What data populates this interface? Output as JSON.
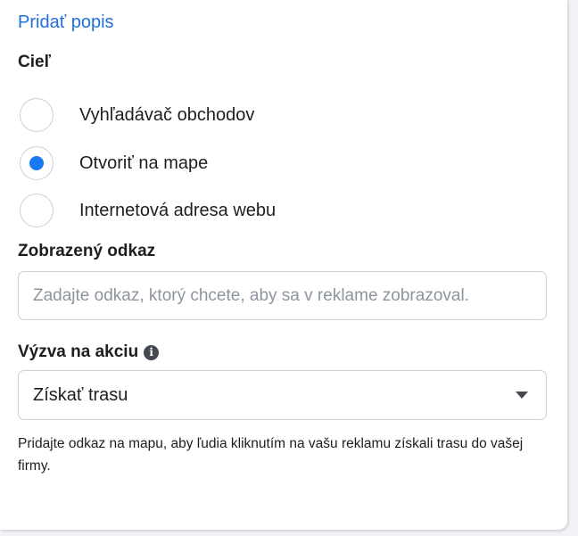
{
  "description_link": "Pridať popis",
  "goal": {
    "label": "Cieľ",
    "options": [
      {
        "label": "Vyhľadávač obchodov",
        "selected": false
      },
      {
        "label": "Otvoriť na mape",
        "selected": true
      },
      {
        "label": "Internetová adresa webu",
        "selected": false
      }
    ]
  },
  "display_link": {
    "label": "Zobrazený odkaz",
    "value": "",
    "placeholder": "Zadajte odkaz, ktorý chcete, aby sa v reklame zobrazoval."
  },
  "cta": {
    "label": "Výzva na akciu",
    "info_icon": "info-icon",
    "selected_value": "Získať trasu",
    "dropdown_icon": "caret-down-icon"
  },
  "helper_text": "Pridajte odkaz na mapu, aby ľudia kliknutím na vašu reklamu získali trasu do vašej firmy.",
  "colors": {
    "link": "#216fdb",
    "radio_selected": "#1877f2",
    "border": "#ccd0d5",
    "text": "#1c1e21",
    "placeholder": "#8d949e"
  }
}
